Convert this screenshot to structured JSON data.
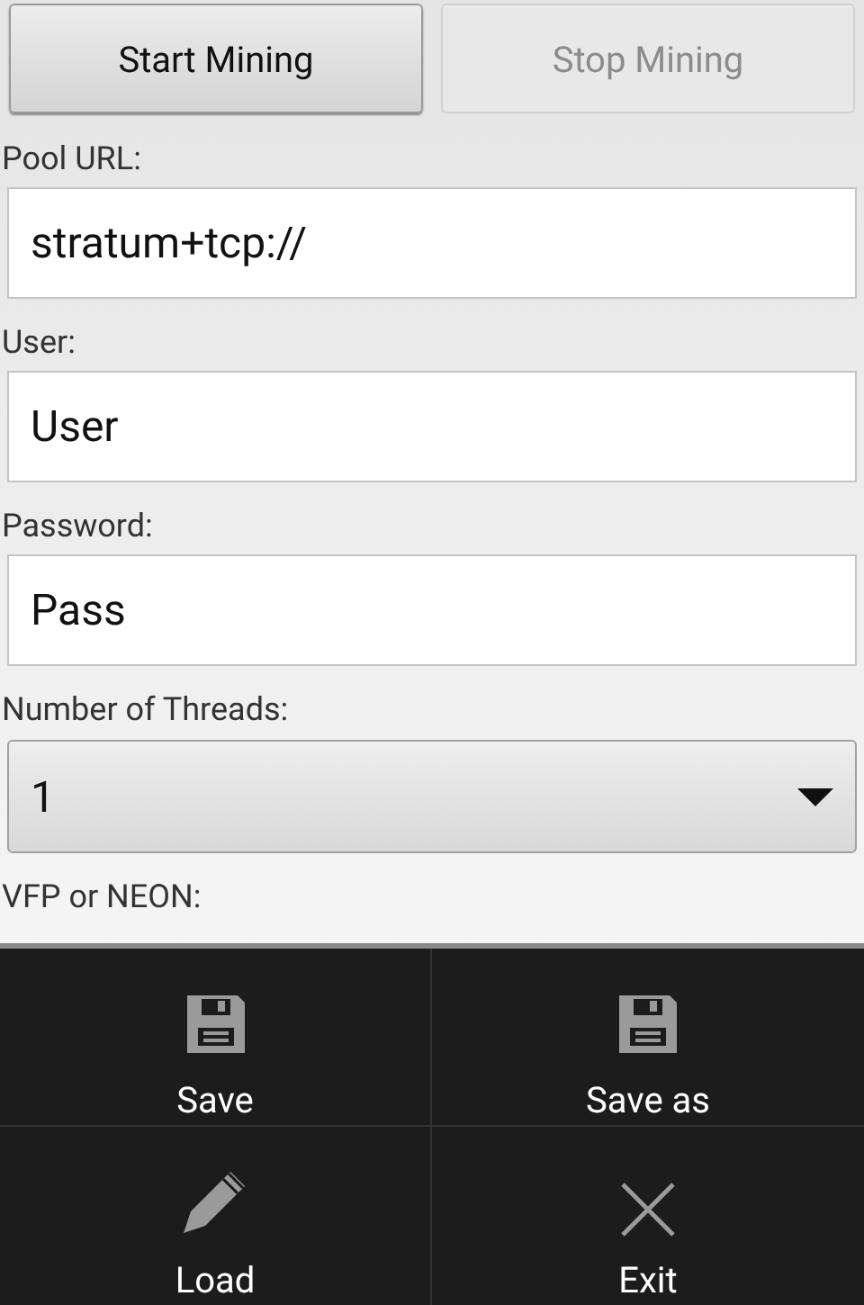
{
  "buttons": [
    {
      "label": "Start Mining",
      "disabled": false
    },
    {
      "label": "Stop Mining",
      "disabled": true
    }
  ],
  "fields": [
    {
      "label": "Pool URL:",
      "value": "stratum+tcp://"
    },
    {
      "label": "User:",
      "value": "User"
    },
    {
      "label": "Password:",
      "value": "Pass"
    }
  ],
  "threads": {
    "label": "Number of Threads:",
    "value": "1"
  },
  "vfp_label": "VFP or NEON:",
  "menu": [
    {
      "label": "Save",
      "kind": "save"
    },
    {
      "label": "Save as",
      "kind": "save"
    },
    {
      "label": "Load",
      "kind": "load"
    },
    {
      "label": "Exit",
      "kind": "exit"
    }
  ]
}
